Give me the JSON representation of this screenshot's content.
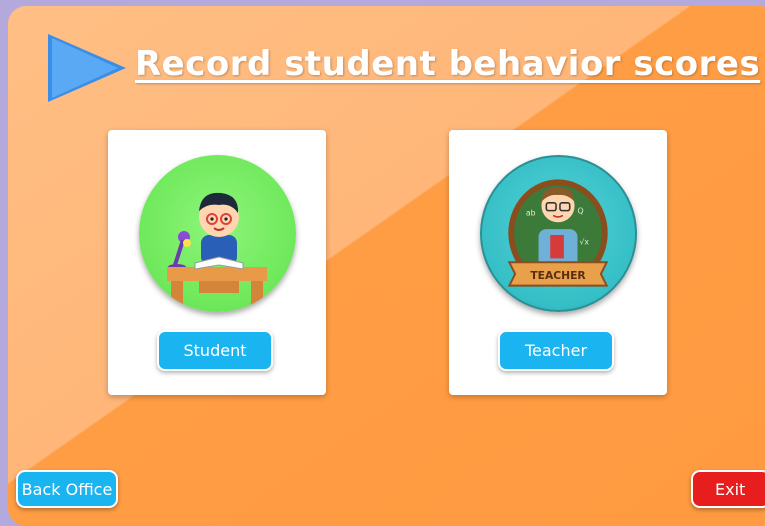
{
  "title": "Record student behavior scores",
  "cards": {
    "student": {
      "button_label": "Student"
    },
    "teacher": {
      "button_label": "Teacher",
      "badge_text": "TEACHER"
    }
  },
  "footer": {
    "back_office_label": "Back Office",
    "exit_label": "Exit"
  },
  "colors": {
    "accent_blue": "#1ab4f0",
    "exit_red": "#e81e1e",
    "background_orange": "#ff9d45"
  }
}
